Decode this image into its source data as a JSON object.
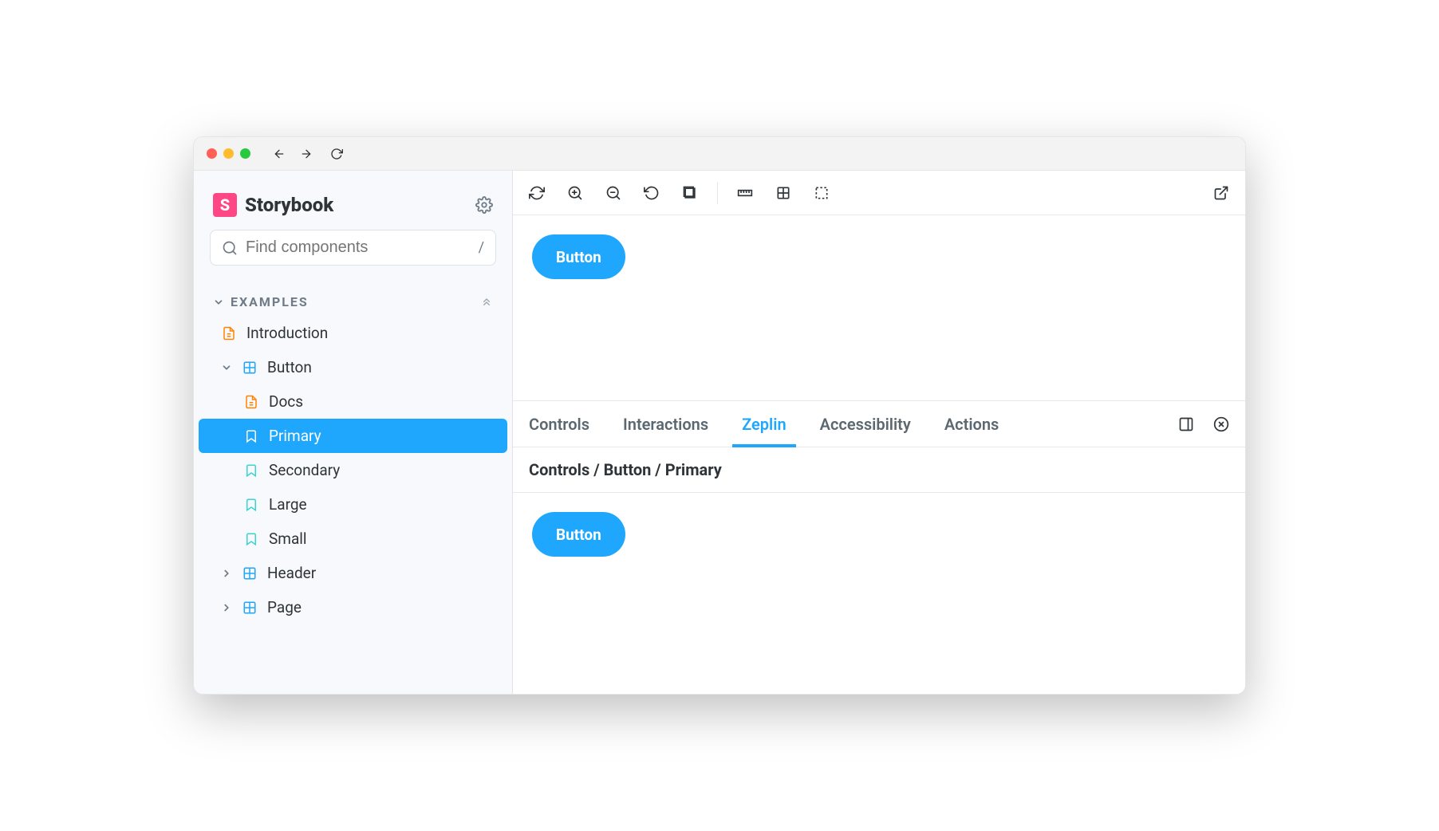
{
  "app": {
    "title": "Storybook"
  },
  "search": {
    "placeholder": "Find components",
    "shortcut": "/"
  },
  "section": {
    "label": "EXAMPLES"
  },
  "tree": {
    "introduction": "Introduction",
    "button": "Button",
    "docs": "Docs",
    "primary": "Primary",
    "secondary": "Secondary",
    "large": "Large",
    "small": "Small",
    "header": "Header",
    "page": "Page"
  },
  "preview": {
    "button_label": "Button"
  },
  "panel": {
    "tabs": {
      "controls": "Controls",
      "interactions": "Interactions",
      "zeplin": "Zeplin",
      "accessibility": "Accessibility",
      "actions": "Actions"
    },
    "breadcrumb": "Controls / Button / Primary",
    "preview_button": "Button"
  }
}
